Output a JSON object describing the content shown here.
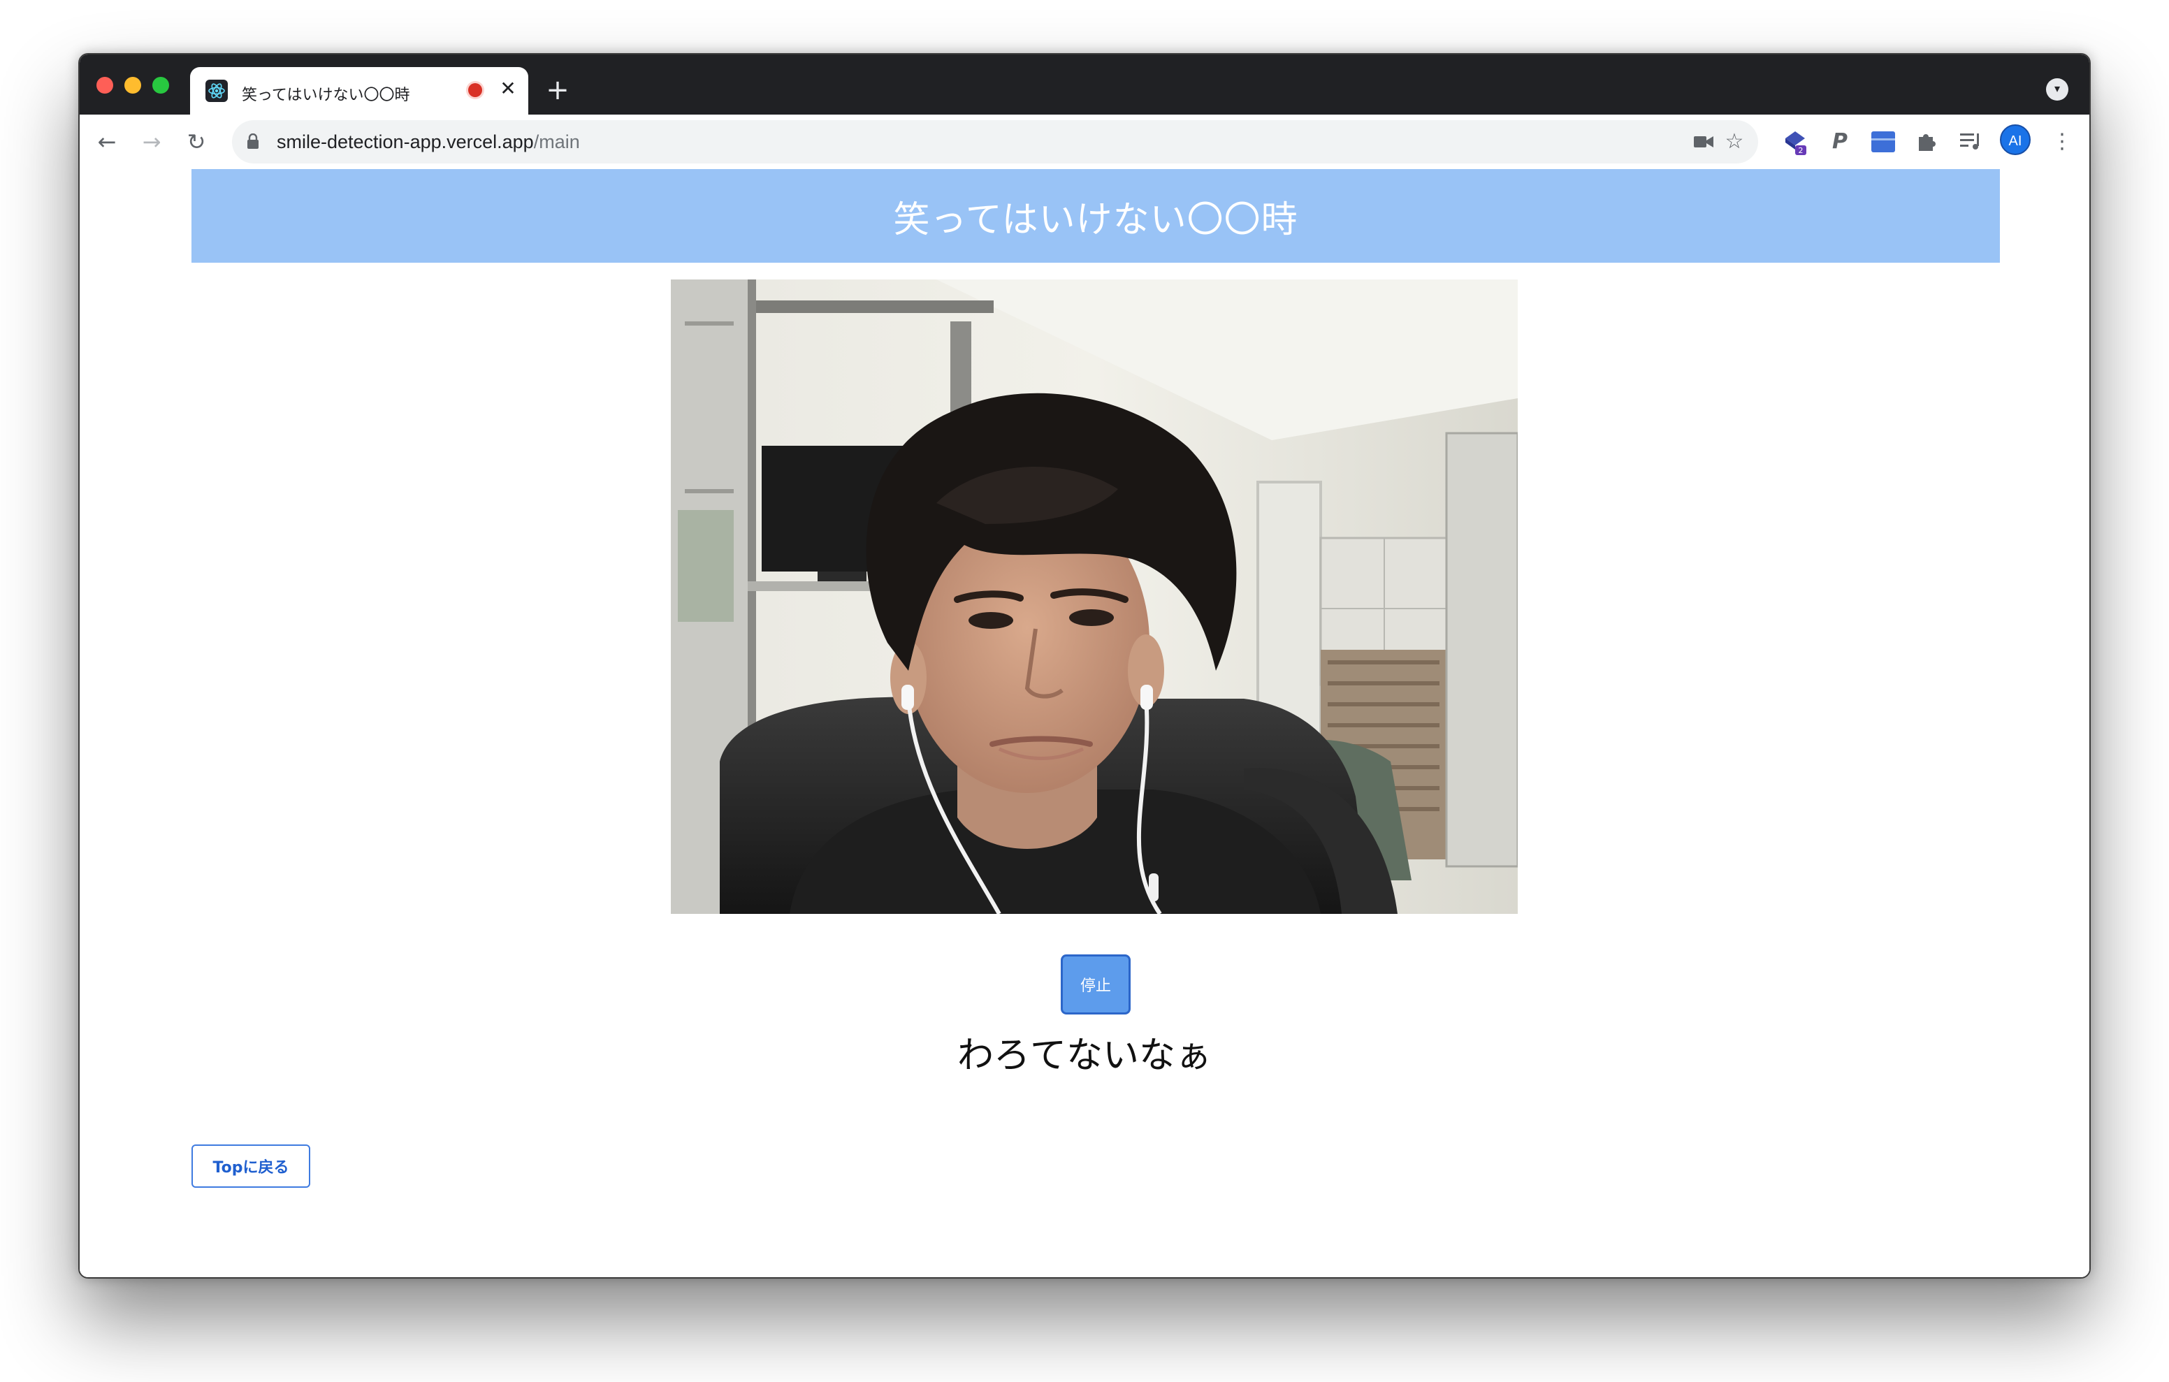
{
  "tab": {
    "title": "笑ってはいけない〇〇時",
    "close_glyph": "✕",
    "new_tab_glyph": "+"
  },
  "toolbar": {
    "back_glyph": "←",
    "forward_glyph": "→",
    "reload_glyph": "↻",
    "url_domain": "smile-detection-app.vercel.app",
    "url_path": "/main",
    "avatar_initials": "AI",
    "extension_badge": "2",
    "menu_glyph": "⋮",
    "icons": [
      "camera-icon",
      "star-icon",
      "extension-icon",
      "paypal-icon",
      "extension-icon",
      "puzzle-icon",
      "media-queue-icon",
      "avatar",
      "menu-icon"
    ]
  },
  "header": {
    "title": "笑ってはいけない〇〇時"
  },
  "controls": {
    "stop_label": "停止",
    "back_to_top_label": "Topに戻る"
  },
  "status": {
    "message": "わろてないなぁ"
  },
  "colors": {
    "header_bg": "#99c3f6",
    "stop_button": "#5d9cec",
    "top_button_border": "#3f7be0"
  }
}
